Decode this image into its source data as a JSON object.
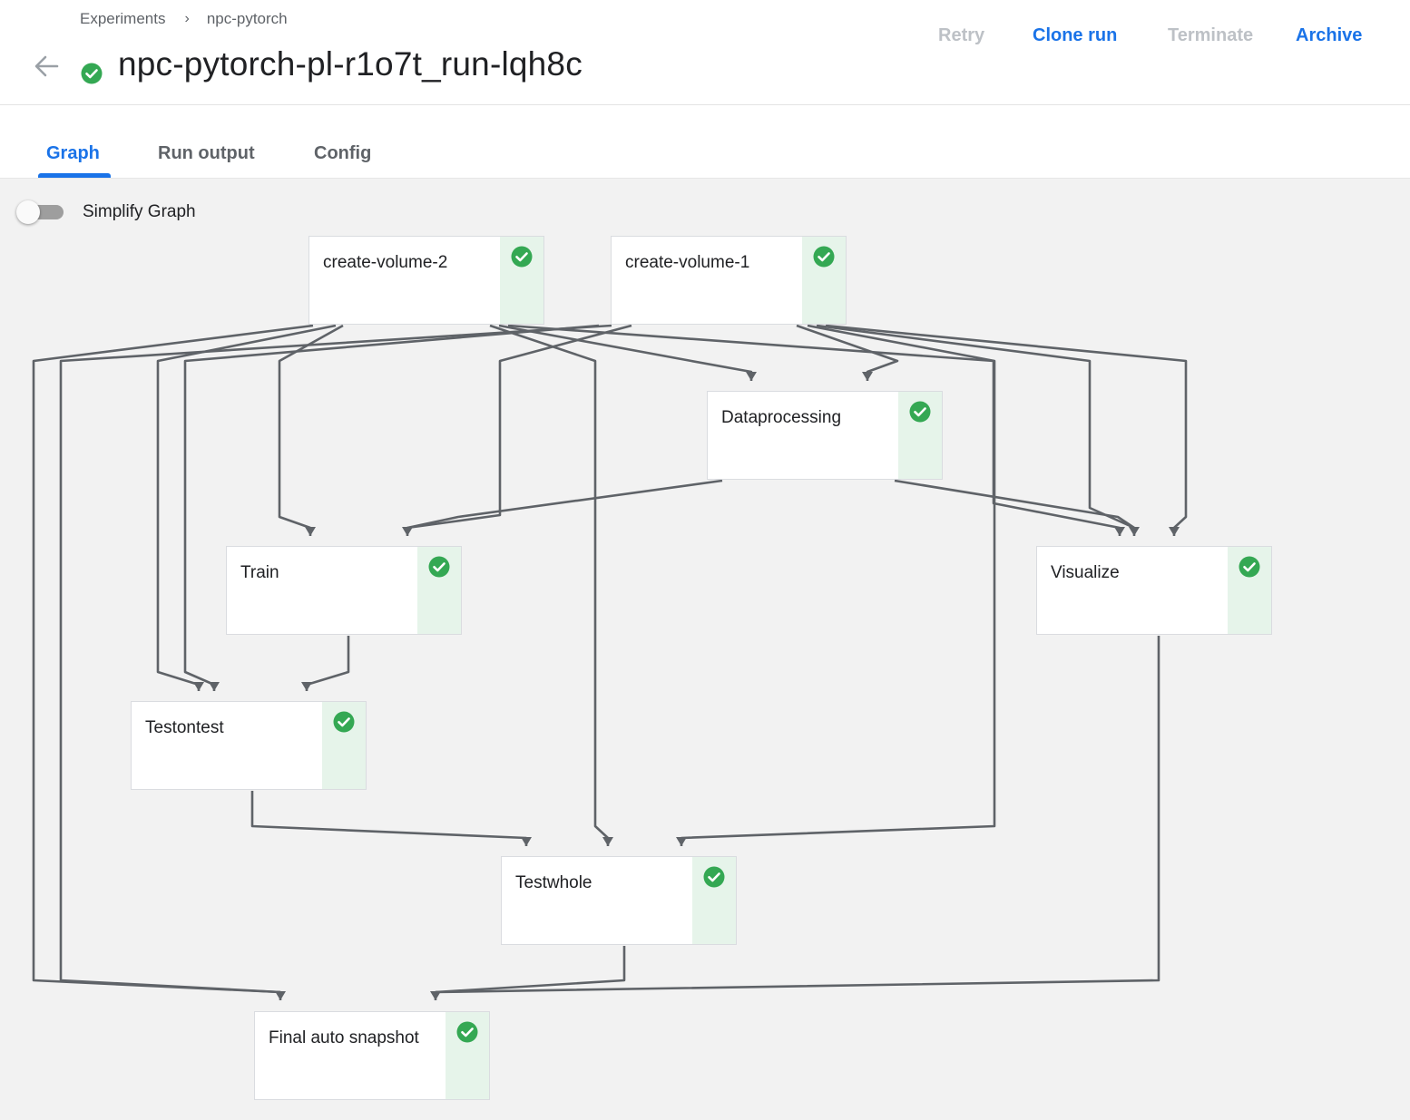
{
  "breadcrumb": {
    "items": [
      "Experiments",
      "npc-pytorch"
    ],
    "separator": "›"
  },
  "run": {
    "title": "npc-pytorch-pl-r1o7t_run-lqh8c",
    "status": "succeeded"
  },
  "actions": {
    "retry": "Retry",
    "clone": "Clone run",
    "terminate": "Terminate",
    "archive": "Archive"
  },
  "tabs": {
    "graph": "Graph",
    "run_output": "Run output",
    "config": "Config",
    "active": "Graph"
  },
  "graph": {
    "simplify_label": "Simplify Graph",
    "simplify_enabled": false,
    "nodes": [
      {
        "label": "create-volume-2",
        "status": "succeeded"
      },
      {
        "label": "create-volume-1",
        "status": "succeeded"
      },
      {
        "label": "Dataprocessing",
        "status": "succeeded"
      },
      {
        "label": "Train",
        "status": "succeeded"
      },
      {
        "label": "Visualize",
        "status": "succeeded"
      },
      {
        "label": "Testontest",
        "status": "succeeded"
      },
      {
        "label": "Testwhole",
        "status": "succeeded"
      },
      {
        "label": "Final auto snapshot",
        "status": "succeeded"
      }
    ]
  },
  "colors": {
    "accent": "#1a73e8",
    "disabled": "#bdc1c6",
    "success": "#34a853",
    "success_bg": "#e6f4ea",
    "edge": "#5f6368"
  }
}
